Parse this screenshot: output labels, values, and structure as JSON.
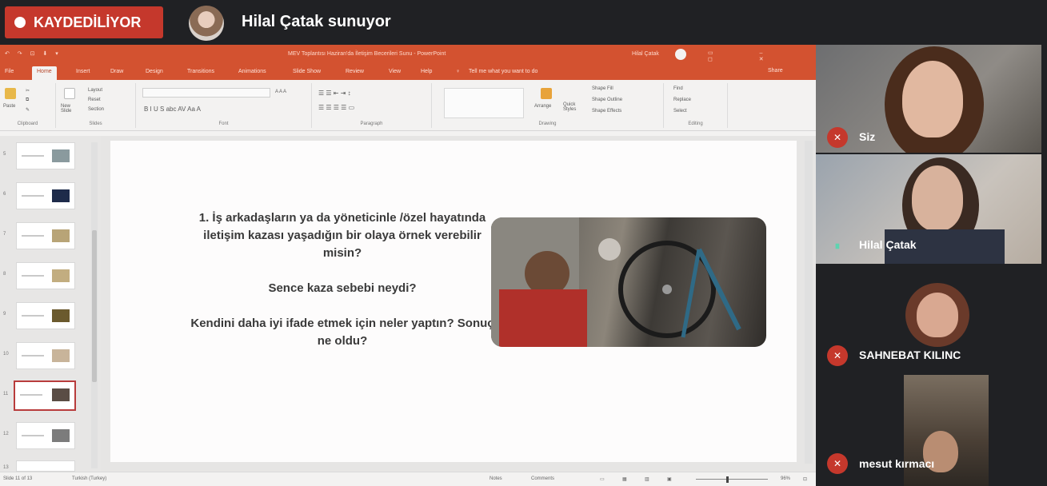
{
  "meeting": {
    "recording_label": "KAYDEDİLİYOR",
    "presenter_text": "Hilal Çatak sunuyor"
  },
  "ppt": {
    "title": {
      "quick_access": "↶ ↷ ⊡ ⬇ ▾",
      "document_name": "MEV Toplantısı Haziran'da İletişim Becerileri Sunu - PowerPoint",
      "user": "Hilal Çatak",
      "window_buttons": "▭ – ◻ ✕"
    },
    "tabs": [
      "File",
      "Home",
      "Insert",
      "Draw",
      "Design",
      "Transitions",
      "Animations",
      "Slide Show",
      "Review",
      "View",
      "Help"
    ],
    "tell_me": "Tell me what you want to do",
    "share": "Share",
    "ribbon": {
      "groups": [
        "Clipboard",
        "Slides",
        "Font",
        "Paragraph",
        "Drawing",
        "Editing"
      ],
      "paste": "Paste",
      "new_slide": "New Slide",
      "layout": "Layout",
      "reset": "Reset",
      "section": "Section",
      "font_buttons": "B  I  U  S  abc  AV  Aa  A",
      "font_size_buttons": "A  A  A",
      "paragraph_row1": "☰  ☰  ⇤  ⇥  ↕",
      "paragraph_row2": "☰  ☰  ☰  ☰  ▭",
      "arrange": "Arrange",
      "quick_styles": "Quick Styles",
      "shape_fill": "Shape Fill",
      "shape_outline": "Shape Outline",
      "shape_effects": "Shape Effects",
      "find": "Find",
      "replace": "Replace",
      "select": "Select"
    },
    "slide_numbers": [
      "5",
      "6",
      "7",
      "8",
      "9",
      "10",
      "11",
      "12",
      "13"
    ],
    "slide": {
      "question1": "1. İş arkadaşların ya da yöneticinle /özel hayatında iletişim kazası yaşadığın bir olaya örnek verebilir misin?",
      "question2": "Sence kaza sebebi neydi?",
      "question3": "Kendini daha iyi ifade etmek için neler yaptın? Sonuç ne oldu?"
    },
    "status": {
      "slide_counter": "Slide 11 of 13",
      "language": "Turkish (Turkey)",
      "notes": "Notes",
      "comments": "Comments",
      "zoom": "96%"
    }
  },
  "participants": [
    {
      "name": "Siz",
      "muted": true
    },
    {
      "name": "Hilal Çatak",
      "muted": false
    },
    {
      "name": "SAHNEBAT KILINC",
      "muted": true
    },
    {
      "name": "mesut kırmacı",
      "muted": true
    }
  ],
  "colors": {
    "recording_red": "#c5382c",
    "ppt_orange": "#d35230",
    "meet_dark": "#202124",
    "selected_thumb": "#b83c3c"
  }
}
